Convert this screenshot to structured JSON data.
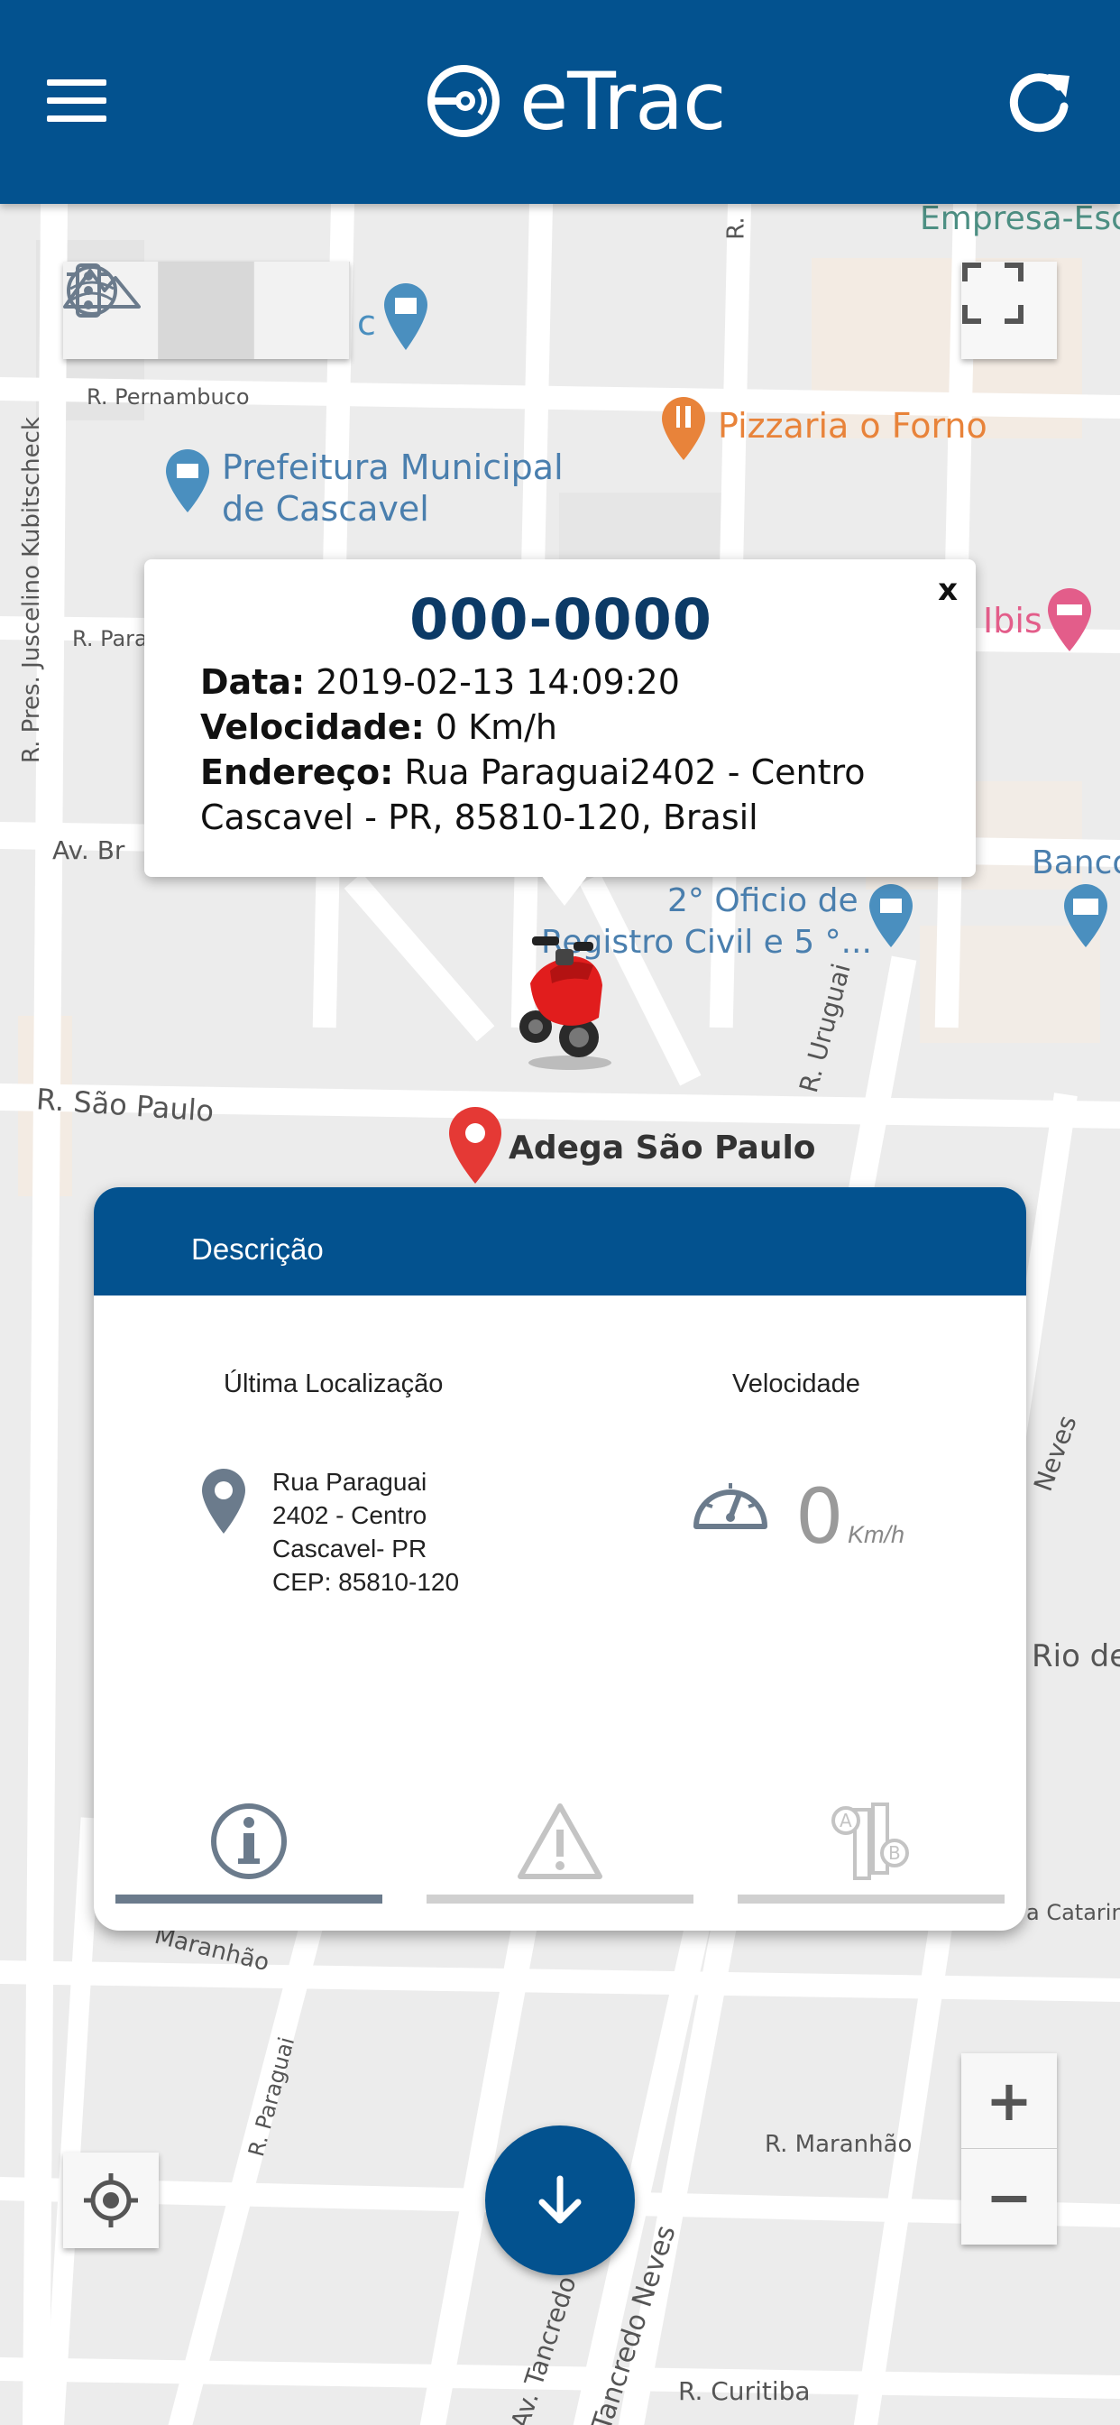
{
  "header": {
    "app_name": "eTrac"
  },
  "map": {
    "labels": {
      "street_pernambuco": "R. Pernambuco",
      "street_kubitscheck": "R. Pres. Juscelino Kubitscheck",
      "street_para": "R. Para",
      "street_av_br": "Av. Br",
      "street_sao_paulo": "R. São Paulo",
      "street_uruguai": "R. Uruguai",
      "street_neves": "Neves",
      "street_rio": "Rio de",
      "street_catarina": "a Catarin",
      "street_maranhao_left": "Maranhão",
      "street_paraguai": "R. Paraguai",
      "street_maranhao_right": "R. Maranhão",
      "street_tancredo": "Av. Tancredo",
      "street_tancredo_neves": "Tancredo Neves",
      "street_curitiba": "R. Curitiba",
      "street_r_top": "R.",
      "poi_empresa": "Empresa-Esc",
      "poi_pizzaria": "Pizzaria o Forno",
      "poi_prefeitura_1": "Prefeitura Municipal",
      "poi_prefeitura_2": "de Cascavel",
      "poi_ibis": "Ibis",
      "poi_banco": "Banco",
      "poi_oficio_1": "2° Oficio de",
      "poi_oficio_2": "Registro Civil e 5 °...",
      "poi_adega": "Adega São Paulo",
      "poi_c": "c"
    },
    "colors": {
      "brand": "#03528f",
      "poi_blue": "#4a8fbf",
      "poi_orange": "#e8833a",
      "poi_pink": "#e35d8a",
      "adega_pin": "#e53935"
    }
  },
  "popup": {
    "plate": "000-0000",
    "close": "x",
    "date_label": "Data:",
    "date_value": "2019-02-13 14:09:20",
    "speed_label": "Velocidade:",
    "speed_value": "0 Km/h",
    "address_label": "Endereço:",
    "address_value_1": "Rua Paraguai2402 - Centro",
    "address_value_2": "Cascavel - PR, 85810-120, Brasil"
  },
  "panel": {
    "title": "Descrição",
    "last_location_title": "Última Localização",
    "speed_title": "Velocidade",
    "address_lines": [
      "Rua Paraguai",
      "2402 - Centro",
      "Cascavel- PR",
      "CEP: 85810-120"
    ],
    "speed_value": "0",
    "speed_unit": "Km/h",
    "tabs": [
      {
        "icon": "info-icon",
        "active": true
      },
      {
        "icon": "warning-icon",
        "active": false
      },
      {
        "icon": "route-ab-icon",
        "active": false
      }
    ]
  },
  "controls": {
    "zoom_in": "+",
    "zoom_out": "−"
  }
}
